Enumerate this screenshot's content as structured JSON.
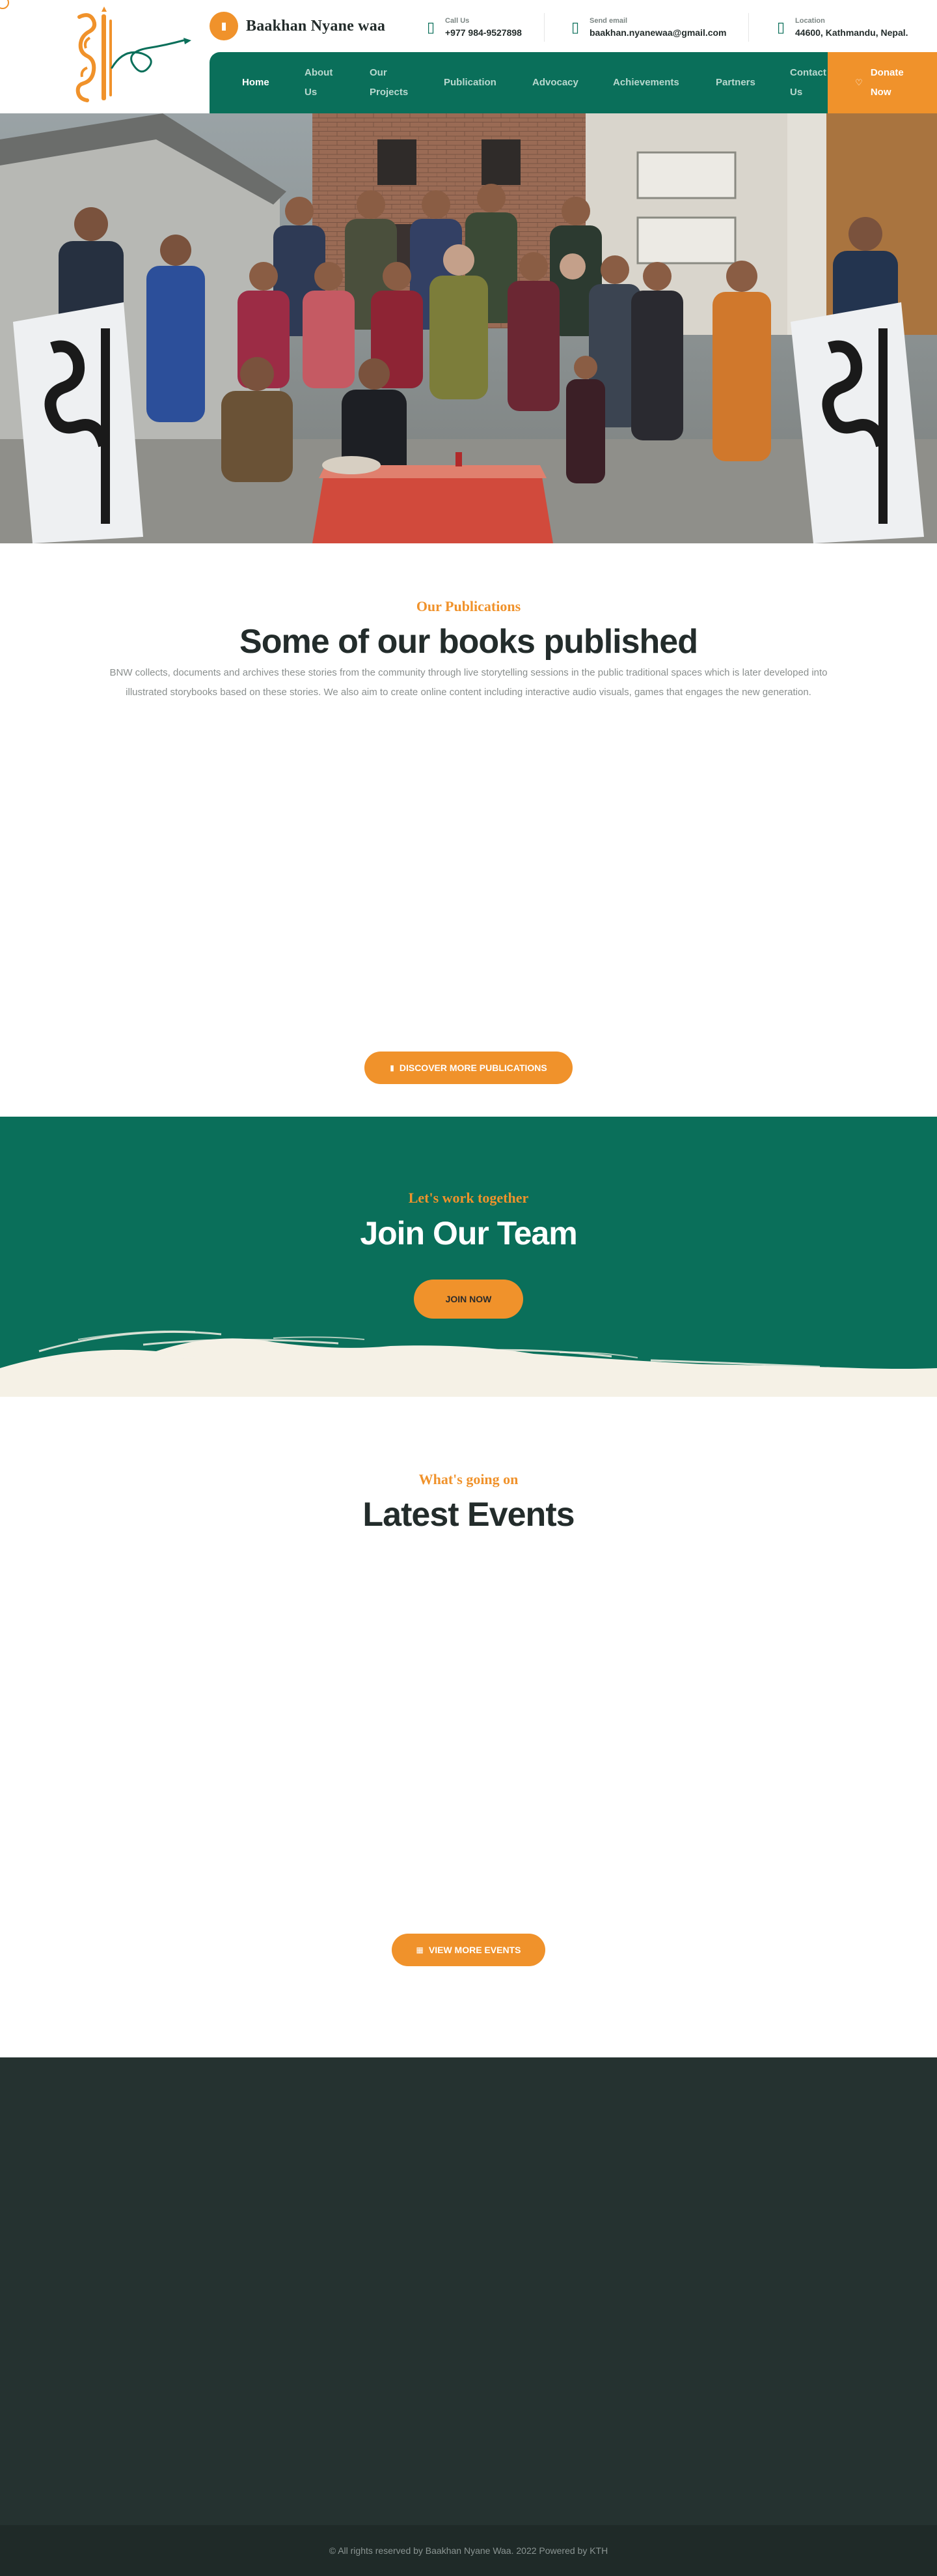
{
  "header": {
    "brand_name": "Baakhan Nyane waa",
    "brand_badge_icon": "book-icon",
    "contacts": [
      {
        "icon": "phone-icon",
        "label": "Call Us",
        "value": "+977 984-9527898"
      },
      {
        "icon": "envelope-icon",
        "label": "Send email",
        "value": "baakhan.nyanewaa@gmail.com"
      },
      {
        "icon": "location-pin-icon",
        "label": "Location",
        "value": "44600, Kathmandu, Nepal."
      }
    ],
    "nav": [
      {
        "label": "Home",
        "active": true
      },
      {
        "label": "About Us",
        "active": false
      },
      {
        "label": "Our Projects",
        "active": false
      },
      {
        "label": "Publication",
        "active": false
      },
      {
        "label": "Advocacy",
        "active": false
      },
      {
        "label": "Achievements",
        "active": false
      },
      {
        "label": "Partners",
        "active": false
      },
      {
        "label": "Contact Us",
        "active": false
      }
    ],
    "donate_label": "Donate Now",
    "donate_icon": "heart-icon"
  },
  "publications": {
    "subtitle": "Our Publications",
    "title": "Some of our books published",
    "description": "BNW collects, documents and archives these stories from the community through live storytelling sessions in the public traditional spaces which is later developed into illustrated storybooks based on these stories. We also aim to create online content including interactive audio visuals, games that engages the new generation.",
    "button_label": "Discover More Publications",
    "button_icon": "book-icon"
  },
  "join": {
    "subtitle": "Let's work together",
    "title": "Join Our Team",
    "button_label": "Join Now"
  },
  "events": {
    "subtitle": "What's going on",
    "title": "Latest Events",
    "button_label": "View More Events",
    "button_icon": "calendar-icon"
  },
  "footer": {
    "copyright": "© All rights reserved by Baakhan Nyane Waa. 2022 Powered by KTH"
  },
  "colors": {
    "primary_green": "#0a6f5a",
    "accent_orange": "#f0922b",
    "dark_text": "#232c2b",
    "footer_bg": "#253230",
    "cream": "#f5f1e6"
  }
}
